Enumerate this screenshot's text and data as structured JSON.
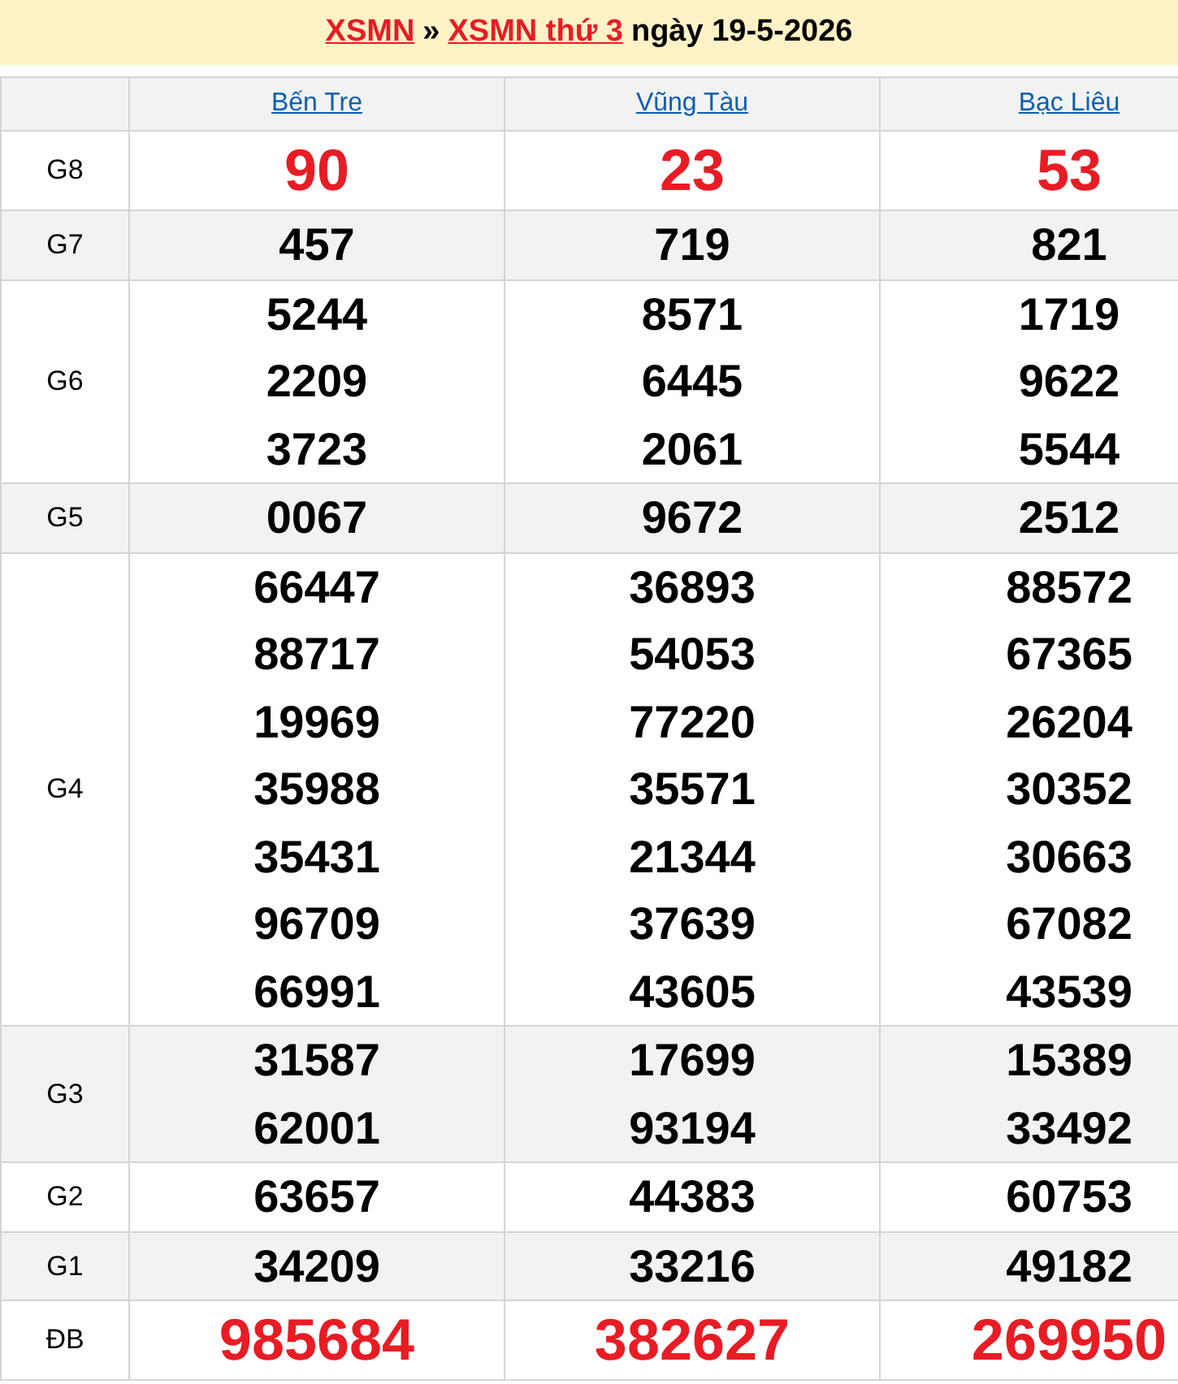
{
  "title": [
    {
      "kind": "link",
      "text": "XSMN"
    },
    {
      "kind": "text",
      "text": "»"
    },
    {
      "kind": "link",
      "text": "XSMN thứ 3"
    },
    {
      "kind": "text",
      "text": "ngày 19-5-2026"
    }
  ],
  "columns": [
    "Bến Tre",
    "Vũng Tàu",
    "Bạc Liêu"
  ],
  "rows": [
    {
      "prize": "G8",
      "kind": "highlight",
      "values": [
        [
          "90"
        ],
        [
          "23"
        ],
        [
          "53"
        ]
      ]
    },
    {
      "prize": "G7",
      "kind": "normal",
      "values": [
        [
          "457"
        ],
        [
          "719"
        ],
        [
          "821"
        ]
      ]
    },
    {
      "prize": "G6",
      "kind": "normal",
      "values": [
        [
          "5244",
          "2209",
          "3723"
        ],
        [
          "8571",
          "6445",
          "2061"
        ],
        [
          "1719",
          "9622",
          "5544"
        ]
      ]
    },
    {
      "prize": "G5",
      "kind": "normal",
      "values": [
        [
          "0067"
        ],
        [
          "9672"
        ],
        [
          "2512"
        ]
      ]
    },
    {
      "prize": "G4",
      "kind": "normal",
      "values": [
        [
          "66447",
          "88717",
          "19969",
          "35988",
          "35431",
          "96709",
          "66991"
        ],
        [
          "36893",
          "54053",
          "77220",
          "35571",
          "21344",
          "37639",
          "43605"
        ],
        [
          "88572",
          "67365",
          "26204",
          "30352",
          "30663",
          "67082",
          "43539"
        ]
      ]
    },
    {
      "prize": "G3",
      "kind": "normal",
      "values": [
        [
          "31587",
          "62001"
        ],
        [
          "17699",
          "93194"
        ],
        [
          "15389",
          "33492"
        ]
      ]
    },
    {
      "prize": "G2",
      "kind": "normal",
      "values": [
        [
          "63657"
        ],
        [
          "44383"
        ],
        [
          "60753"
        ]
      ]
    },
    {
      "prize": "G1",
      "kind": "normal",
      "values": [
        [
          "34209"
        ],
        [
          "33216"
        ],
        [
          "49182"
        ]
      ]
    },
    {
      "prize": "ĐB",
      "kind": "highlight",
      "values": [
        [
          "985684"
        ],
        [
          "382627"
        ],
        [
          "269950"
        ]
      ]
    }
  ]
}
